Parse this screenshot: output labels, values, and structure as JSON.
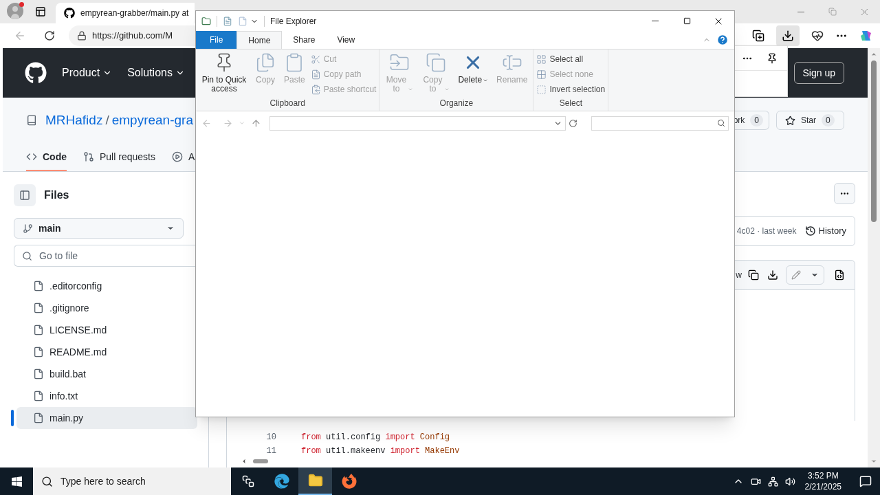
{
  "browser": {
    "tab_title": "empyrean-grabber/main.py at",
    "url": "https://github.com/M"
  },
  "github": {
    "nav": [
      "Product",
      "Solutions"
    ],
    "sign_up": "Sign up",
    "owner": "MRHafidz",
    "separator": "/",
    "repo": "empyrean-gra",
    "tabs": [
      {
        "label": "Code",
        "selected": true
      },
      {
        "label": "Pull requests",
        "selected": false
      },
      {
        "label": "A",
        "selected": false
      }
    ],
    "fork": {
      "label": "ork",
      "count": "0"
    },
    "star": {
      "label": "Star",
      "count": "0"
    },
    "files_title": "Files",
    "branch": "main",
    "go_to_file": {
      "placeholder": "Go to file"
    },
    "files": [
      {
        "name": ".editorconfig",
        "selected": false
      },
      {
        "name": ".gitignore",
        "selected": false
      },
      {
        "name": "LICENSE.md",
        "selected": false
      },
      {
        "name": "README.md",
        "selected": false
      },
      {
        "name": "build.bat",
        "selected": false
      },
      {
        "name": "info.txt",
        "selected": false
      },
      {
        "name": "main.py",
        "selected": true
      }
    ],
    "commit": "4c02 · last week",
    "history": "History",
    "raw_fragment": "w",
    "code_lines": [
      {
        "number": "10",
        "tokens": [
          {
            "kind": "keyword",
            "text": "from"
          },
          {
            "kind": "plain",
            "text": "util.config"
          },
          {
            "kind": "keyword",
            "text": "import"
          },
          {
            "kind": "name",
            "text": "Config"
          }
        ]
      },
      {
        "number": "11",
        "tokens": [
          {
            "kind": "keyword",
            "text": "from"
          },
          {
            "kind": "plain",
            "text": "util.makeenv"
          },
          {
            "kind": "keyword",
            "text": "import"
          },
          {
            "kind": "name",
            "text": "MakeEnv"
          }
        ]
      }
    ]
  },
  "explorer": {
    "title": "File Explorer",
    "tabs": [
      {
        "label": "File",
        "kind": "file",
        "selected": false
      },
      {
        "label": "Home",
        "kind": "tab",
        "selected": true
      },
      {
        "label": "Share",
        "kind": "tab",
        "selected": false
      },
      {
        "label": "View",
        "kind": "tab",
        "selected": false
      }
    ],
    "groups": [
      {
        "label": "Clipboard",
        "items": [
          {
            "label": "Pin to Quick access",
            "kind": "large",
            "disabled": false,
            "dropdown": false
          },
          {
            "label": "Copy",
            "kind": "large",
            "disabled": true,
            "dropdown": false
          },
          {
            "label": "Paste",
            "kind": "large",
            "disabled": true,
            "dropdown": false
          },
          {
            "label": "Cut",
            "kind": "small",
            "disabled": true,
            "dropdown": false
          },
          {
            "label": "Copy path",
            "kind": "small",
            "disabled": true,
            "dropdown": false
          },
          {
            "label": "Paste shortcut",
            "kind": "small",
            "disabled": true,
            "dropdown": false
          }
        ]
      },
      {
        "label": "Organize",
        "items": [
          {
            "label": "Move to",
            "kind": "large",
            "disabled": true,
            "dropdown": true
          },
          {
            "label": "Copy to",
            "kind": "large",
            "disabled": true,
            "dropdown": true
          },
          {
            "label": "Delete",
            "kind": "large",
            "disabled": false,
            "dropdown": true
          },
          {
            "label": "Rename",
            "kind": "large",
            "disabled": true,
            "dropdown": false
          }
        ]
      },
      {
        "label": "Select",
        "items": [
          {
            "label": "Select all",
            "kind": "small",
            "disabled": false,
            "dropdown": false
          },
          {
            "label": "Select none",
            "kind": "small",
            "disabled": true,
            "dropdown": false
          },
          {
            "label": "Invert selection",
            "kind": "small",
            "disabled": false,
            "dropdown": false
          }
        ]
      }
    ]
  },
  "taskbar": {
    "search": {
      "placeholder": "Type here to search"
    },
    "apps": [
      {
        "kind": "taskview",
        "selected": false
      },
      {
        "kind": "edge",
        "selected": false
      },
      {
        "kind": "explorer",
        "selected": true
      },
      {
        "kind": "firefox",
        "selected": false
      }
    ],
    "time": "3:52 PM",
    "date": "2/21/2025"
  }
}
